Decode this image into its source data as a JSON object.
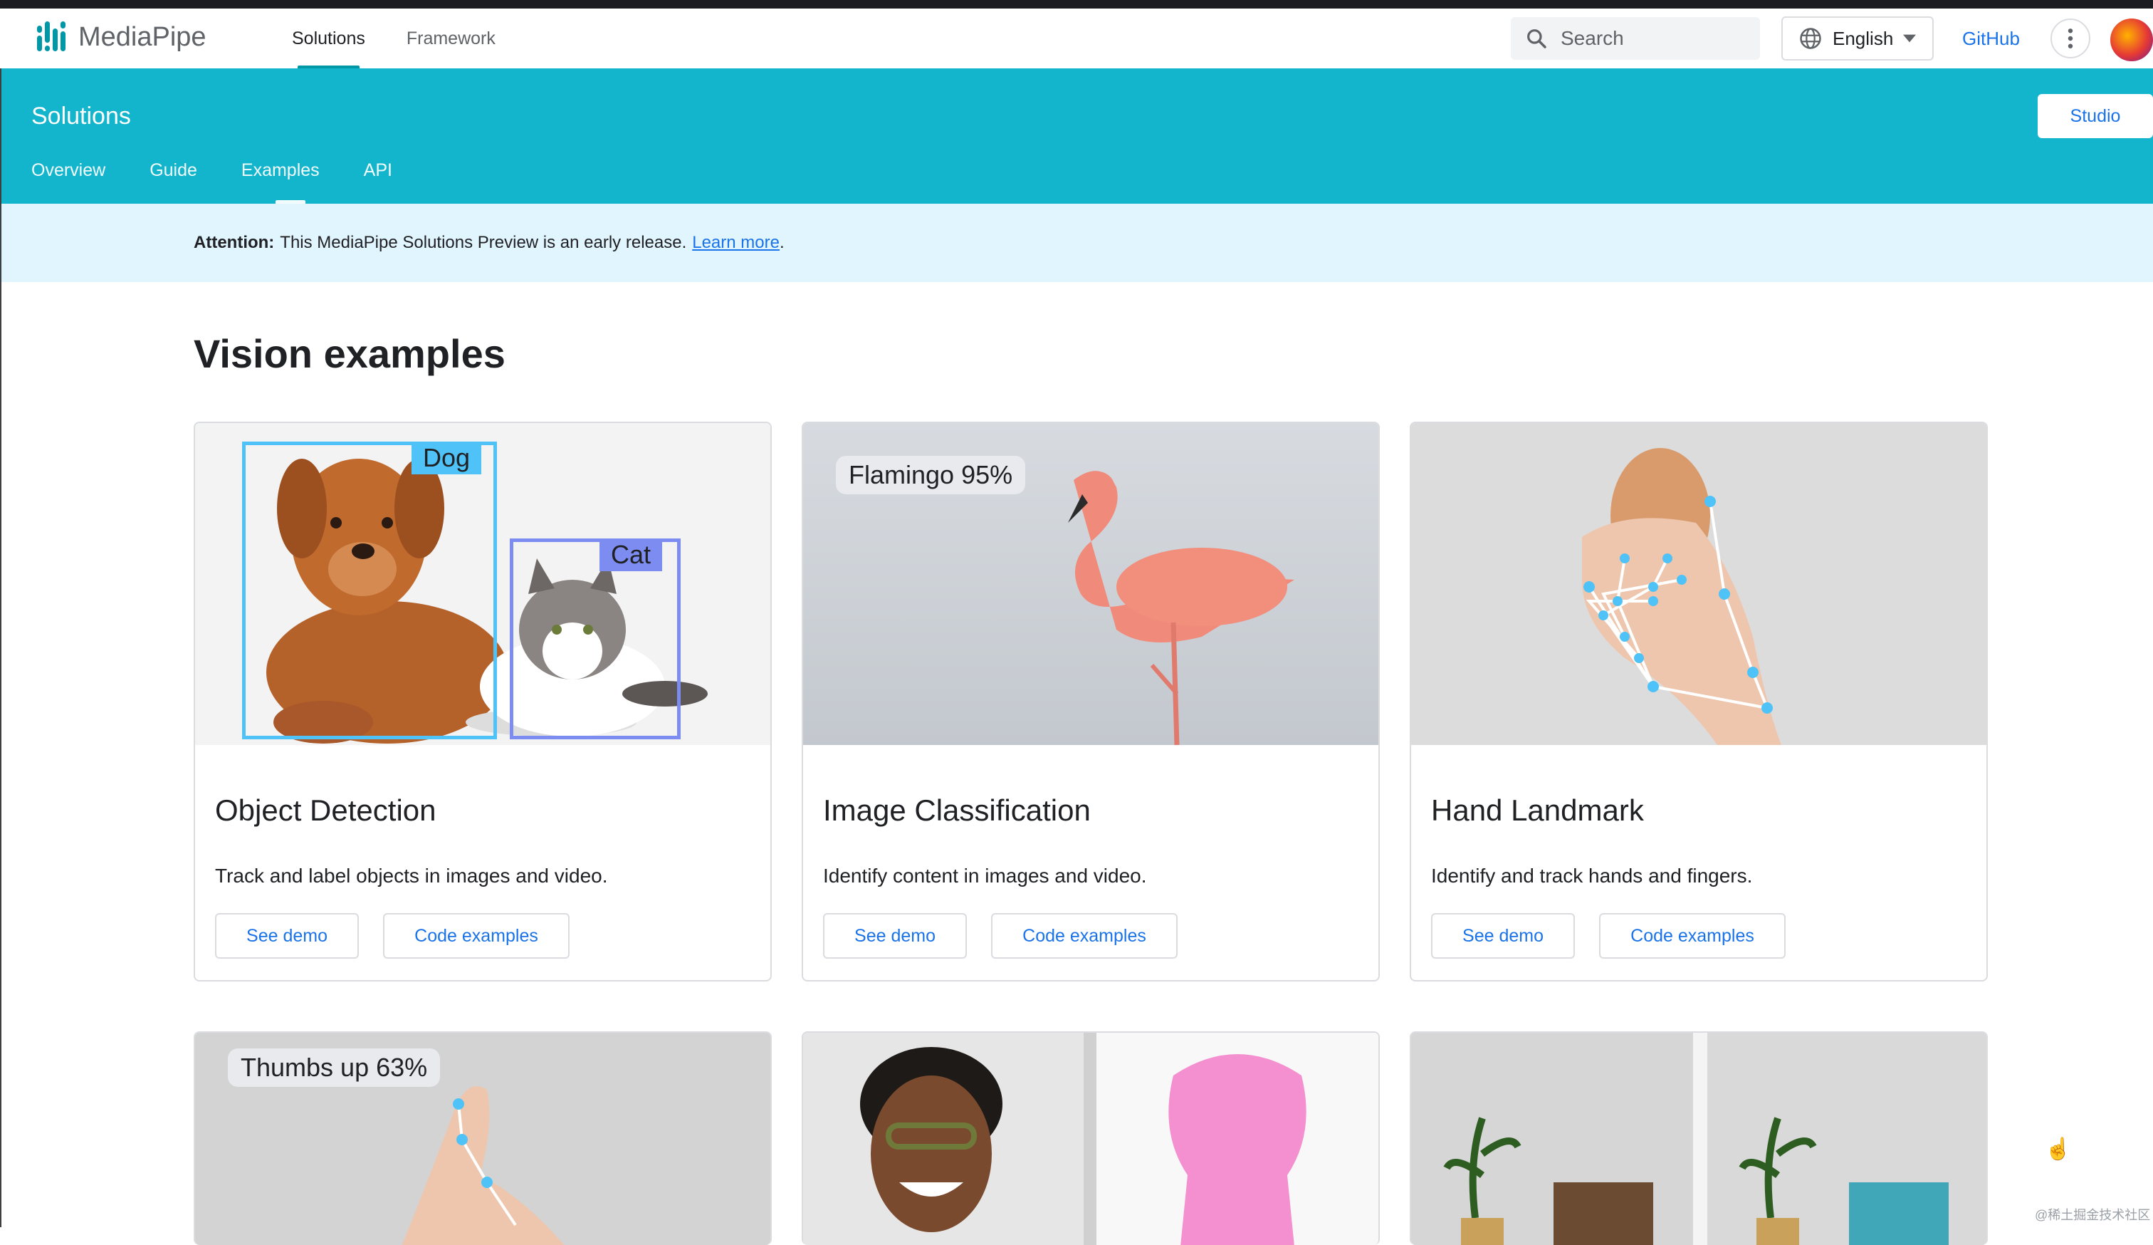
{
  "nav": {
    "logo_text": "MediaPipe",
    "links": [
      {
        "label": "Solutions",
        "active": true
      },
      {
        "label": "Framework",
        "active": false
      }
    ],
    "search_placeholder": "Search",
    "language": "English",
    "github": "GitHub"
  },
  "header": {
    "title": "Solutions",
    "studio_button": "Studio",
    "tabs": [
      {
        "label": "Overview"
      },
      {
        "label": "Guide"
      },
      {
        "label": "Examples",
        "active": true
      },
      {
        "label": "API"
      }
    ]
  },
  "banner": {
    "prefix": "Attention:",
    "text": "This MediaPipe Solutions Preview is an early release.",
    "link": "Learn more",
    "suffix": "."
  },
  "section_title": "Vision examples",
  "cards": [
    {
      "title": "Object Detection",
      "desc": "Track and label objects in images and video.",
      "btn_demo": "See demo",
      "btn_code": "Code examples",
      "labels": [
        "Dog",
        "Cat"
      ]
    },
    {
      "title": "Image Classification",
      "desc": "Identify content in images and video.",
      "btn_demo": "See demo",
      "btn_code": "Code examples",
      "labels": [
        "Flamingo 95%"
      ]
    },
    {
      "title": "Hand Landmark",
      "desc": "Identify and track hands and fingers.",
      "btn_demo": "See demo",
      "btn_code": "Code examples"
    }
  ],
  "row2_labels": [
    "Thumbs up 63%"
  ],
  "watermark": "@稀土掘金技术社区",
  "colors": {
    "accent": "#12b5cb",
    "link": "#1a73e8",
    "dog_box": "#4fc3f7",
    "cat_box": "#7c8cf0"
  }
}
